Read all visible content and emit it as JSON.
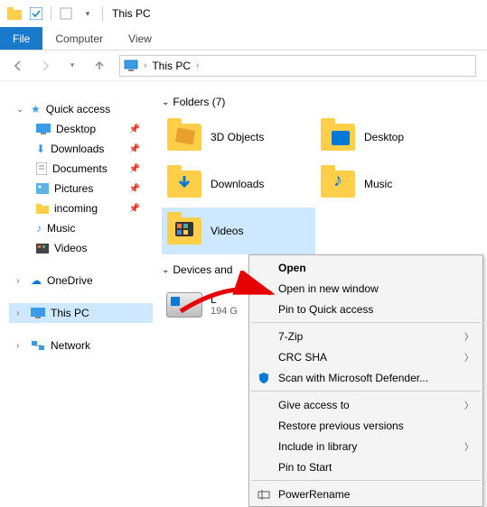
{
  "titlebar": {
    "title": "This PC"
  },
  "ribbon": {
    "file": "File",
    "computer": "Computer",
    "view": "View"
  },
  "breadcrumb": {
    "root": "This PC"
  },
  "sidebar": {
    "quick": "Quick access",
    "items": [
      {
        "label": "Desktop"
      },
      {
        "label": "Downloads"
      },
      {
        "label": "Documents"
      },
      {
        "label": "Pictures"
      },
      {
        "label": "incoming"
      },
      {
        "label": "Music"
      },
      {
        "label": "Videos"
      }
    ],
    "onedrive": "OneDrive",
    "thispc": "This PC",
    "network": "Network"
  },
  "content": {
    "folders_header": "Folders (7)",
    "devices_header": "Devices and",
    "folders": [
      {
        "label": "3D Objects"
      },
      {
        "label": "Desktop"
      },
      {
        "label": "Downloads"
      },
      {
        "label": "Music"
      },
      {
        "label": "Videos"
      }
    ],
    "drive": {
      "line1": "L",
      "line2": "194 G"
    }
  },
  "context": {
    "open": "Open",
    "new_window": "Open in new window",
    "pin": "Pin to Quick access",
    "seven": "7-Zip",
    "crc": "CRC SHA",
    "defender": "Scan with Microsoft Defender...",
    "give": "Give access to",
    "restore": "Restore previous versions",
    "library": "Include in library",
    "pin_start": "Pin to Start",
    "rename": "PowerRename"
  }
}
